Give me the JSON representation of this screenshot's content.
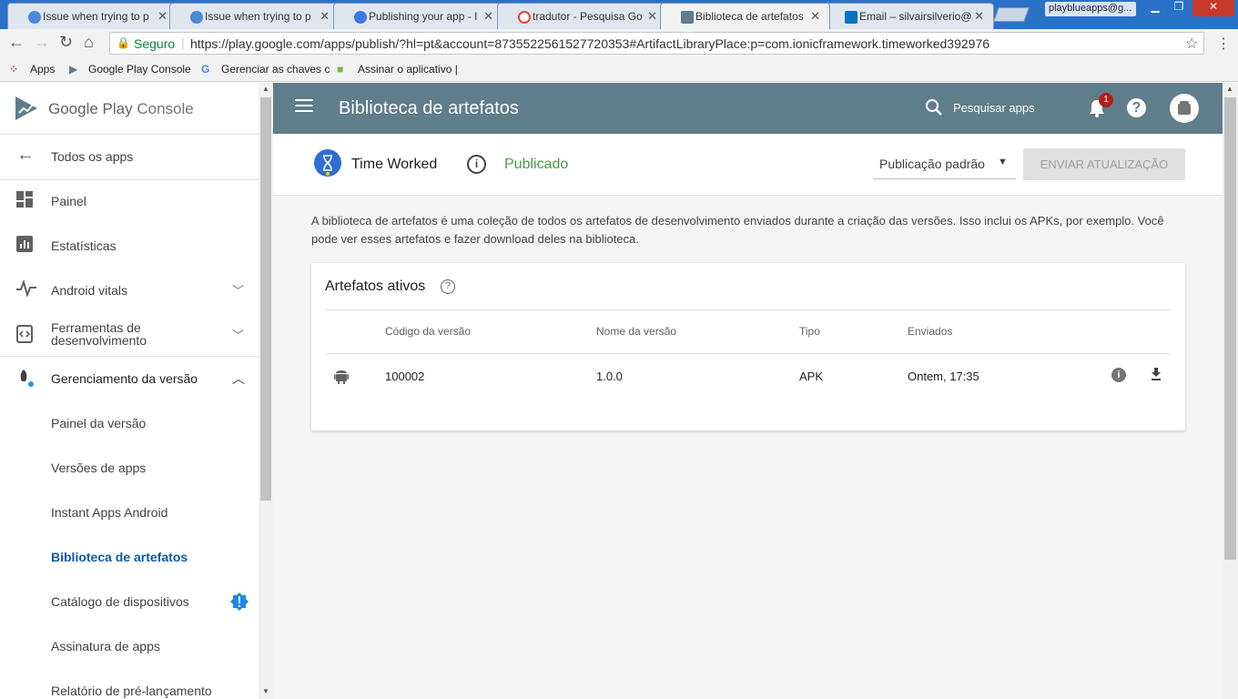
{
  "browser": {
    "tabs": [
      {
        "title": "Issue when trying to p",
        "icon_color": "#4a8ad8"
      },
      {
        "title": "Issue when trying to p",
        "icon_color": "#4a8ad8"
      },
      {
        "title": "Publishing your app - I",
        "icon_color": "#3b78e7"
      },
      {
        "title": "tradutor - Pesquisa Go",
        "icon_color": "#ea4335"
      },
      {
        "title": "Biblioteca de artefatos",
        "icon_color": "#607d8b"
      },
      {
        "title": "Email – silvairsilverio@",
        "icon_color": "#0072c6"
      }
    ],
    "profile": "playblueapps@g...",
    "secure_label": "Seguro",
    "url": "https://play.google.com/apps/publish/?hl=pt&account=8735522561527720353#ArtifactLibraryPlace:p=com.ionicframework.timeworked392976",
    "bookmarks": [
      "Apps",
      "Google Play Console",
      "Gerenciar as chaves c",
      "Assinar o aplicativo |"
    ]
  },
  "sidebar": {
    "brand_google_play": "Google Play",
    "brand_console": "Console",
    "items": [
      {
        "label": "Todos os apps"
      },
      {
        "label": "Painel"
      },
      {
        "label": "Estatísticas"
      },
      {
        "label": "Android vitals"
      },
      {
        "label": "Ferramentas de desenvolvimento"
      },
      {
        "label": "Gerenciamento da versão"
      }
    ],
    "sub_items": [
      {
        "label": "Painel da versão"
      },
      {
        "label": "Versões de apps"
      },
      {
        "label": "Instant Apps Android"
      },
      {
        "label": "Biblioteca de artefatos"
      },
      {
        "label": "Catálogo de dispositivos"
      },
      {
        "label": "Assinatura de apps"
      },
      {
        "label": "Relatório de pré-lançamento"
      }
    ]
  },
  "appbar": {
    "title": "Biblioteca de artefatos",
    "search_label": "Pesquisar apps",
    "notification_count": "1"
  },
  "subbar": {
    "app_name": "Time Worked",
    "status": "Publicado",
    "publication_select": "Publicação padrão",
    "submit_button": "ENVIAR ATUALIZAÇÃO"
  },
  "content": {
    "description": "A biblioteca de artefatos é uma coleção de todos os artefatos de desenvolvimento enviados durante a criação das versões. Isso inclui os APKs, por exemplo. Você pode ver esses artefatos e fazer download deles na biblioteca.",
    "card_title": "Artefatos ativos",
    "columns": [
      "Código da versão",
      "Nome da versão",
      "Tipo",
      "Enviados"
    ],
    "rows": [
      {
        "version_code": "100002",
        "version_name": "1.0.0",
        "type": "APK",
        "uploaded": "Ontem, 17:35"
      }
    ]
  },
  "colors": {
    "appbar": "#607d8b",
    "status_green": "#43a047",
    "active_link": "#0d5aa7",
    "tab_bar": "#2a71c8"
  }
}
